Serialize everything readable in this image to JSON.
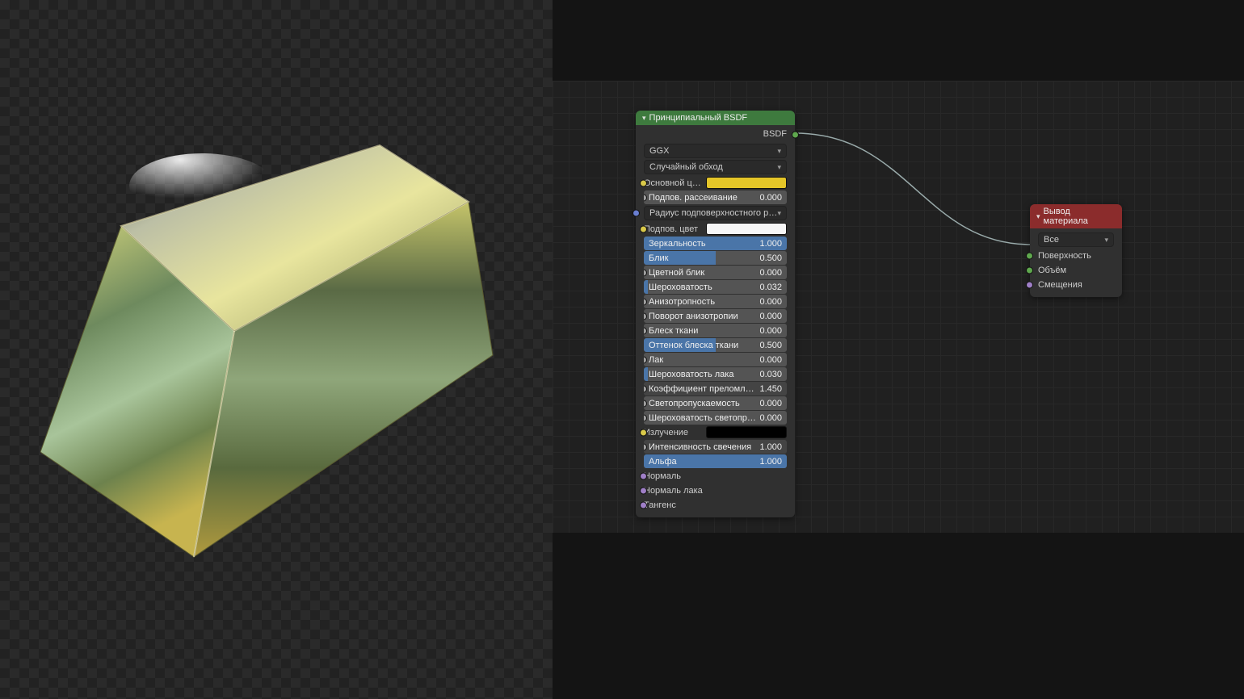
{
  "viewport": {
    "description": "gold-bar-render"
  },
  "bsdf_node": {
    "title": "Принципиальный BSDF",
    "output_label": "BSDF",
    "distribution": "GGX",
    "subsurface_method": "Случайный обход",
    "base_color_label": "Основной цве",
    "base_color": "#e5c628",
    "subsurface_scatter": {
      "label": "Подпов. рассеивание",
      "value": "0.000"
    },
    "subsurface_radius_label": "Радиус подповерхностного рассе..",
    "subsurface_color_label": "Подпов. цвет",
    "subsurface_color": "#f7f7f7",
    "metallic": {
      "label": "Зеркальность",
      "value": "1.000",
      "fill": 100
    },
    "specular": {
      "label": "Блик",
      "value": "0.500",
      "fill": 50
    },
    "specular_tint": {
      "label": "Цветной блик",
      "value": "0.000",
      "fill": 0
    },
    "roughness": {
      "label": "Шероховатость",
      "value": "0.032",
      "fill": 3
    },
    "anisotropic": {
      "label": "Анизотропность",
      "value": "0.000",
      "fill": 0
    },
    "anisotropic_rotation": {
      "label": "Поворот анизотропии",
      "value": "0.000",
      "fill": 0
    },
    "sheen": {
      "label": "Блеск ткани",
      "value": "0.000",
      "fill": 0
    },
    "sheen_tint": {
      "label": "Оттенок блеска ткани",
      "value": "0.500",
      "fill": 50
    },
    "clearcoat": {
      "label": "Лак",
      "value": "0.000",
      "fill": 0
    },
    "clearcoat_roughness": {
      "label": "Шероховатость лака",
      "value": "0.030",
      "fill": 3
    },
    "ior": {
      "label": "Коэффициент преломлени",
      "value": "1.450"
    },
    "transmission": {
      "label": "Светопропускаемость",
      "value": "0.000",
      "fill": 0
    },
    "transmission_roughness": {
      "label": "Шероховатость светопропус",
      "value": "0.000",
      "fill": 0
    },
    "emission_label": "Излучение",
    "emission_color": "#000000",
    "emission_strength": {
      "label": "Интенсивность свечения",
      "value": "1.000"
    },
    "alpha": {
      "label": "Альфа",
      "value": "1.000",
      "fill": 100
    },
    "normal_label": "Нормаль",
    "clearcoat_normal_label": "Нормаль лака",
    "tangent_label": "Тангенс"
  },
  "output_node": {
    "title": "Вывод материала",
    "target": "Все",
    "surface_label": "Поверхность",
    "volume_label": "Объём",
    "displacement_label": "Смещения"
  }
}
